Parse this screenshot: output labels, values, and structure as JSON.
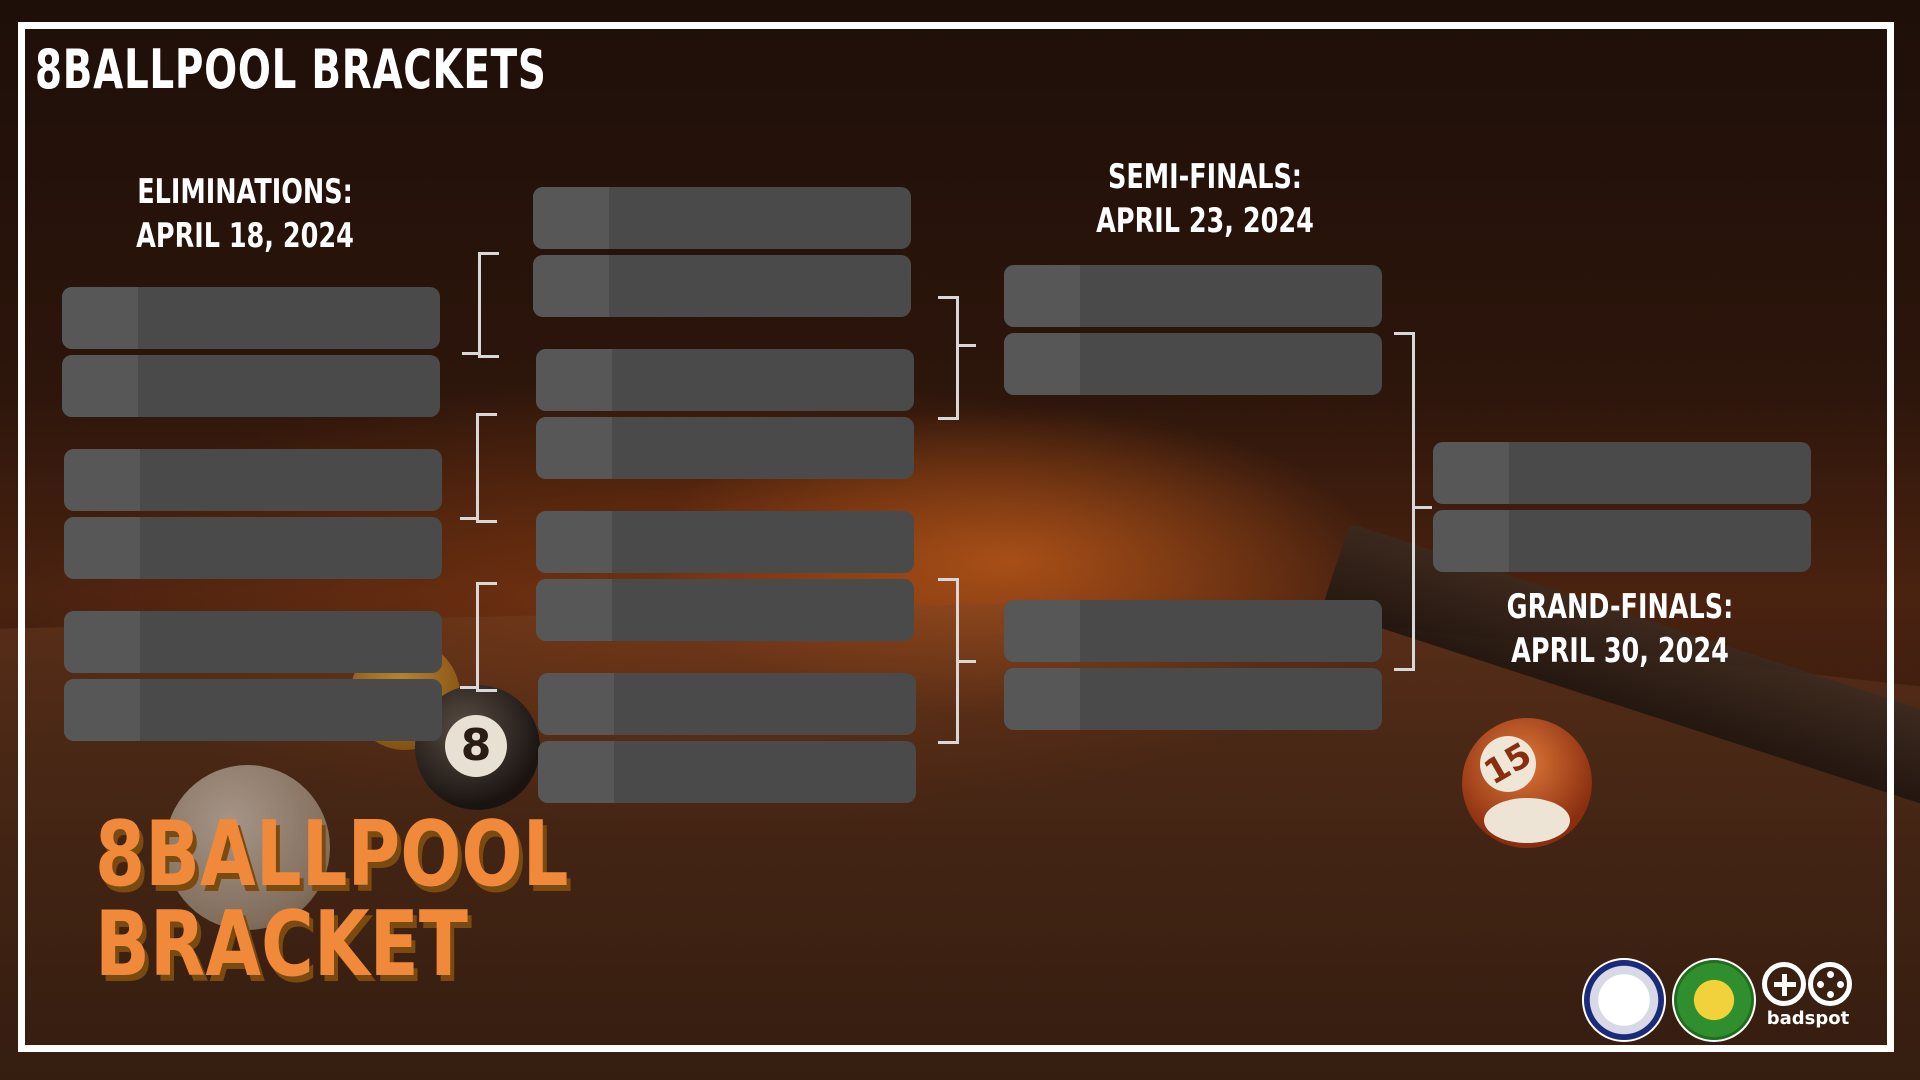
{
  "header": {
    "title": "8BALLPOOL BRACKETS"
  },
  "stages": {
    "eliminations": {
      "label": "ELIMINATIONS:",
      "date": "APRIL 18, 2024"
    },
    "semifinals": {
      "label": "SEMI-FINALS:",
      "date": "APRIL 23, 2024"
    },
    "grandfinals": {
      "label": "GRAND-FINALS:",
      "date": "APRIL 30, 2024"
    }
  },
  "branding": {
    "title_line1": "8BALLPOOL",
    "title_line2": "BRACKET",
    "sponsor": "badspot"
  },
  "balls": {
    "eight": "8",
    "fifteen": "15"
  },
  "colors": {
    "slot": "#4a4a4a",
    "seed_cell": "#575757",
    "accent": "#f08a3a",
    "frame": "#ffffff"
  }
}
